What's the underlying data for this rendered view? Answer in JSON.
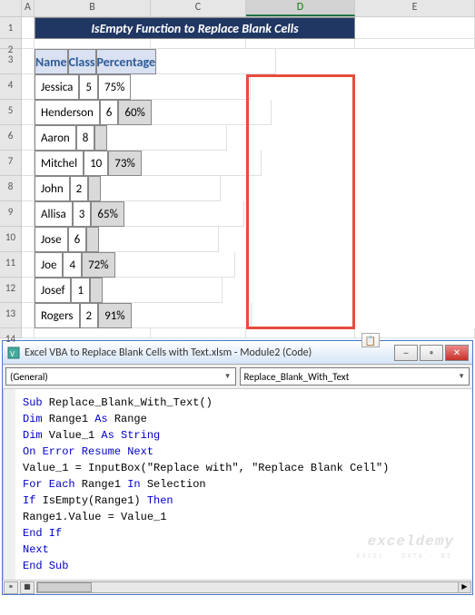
{
  "columns": [
    "A",
    "B",
    "C",
    "D",
    "E"
  ],
  "row_nums": [
    "1",
    "2",
    "3",
    "4",
    "5",
    "6",
    "7",
    "8",
    "9",
    "10",
    "11",
    "12",
    "13",
    "14"
  ],
  "selected_col": "D",
  "title": "IsEmpty Function to Replace Blank Cells",
  "headers": {
    "name": "Name",
    "class": "Class",
    "pct": "Percentage"
  },
  "data": [
    {
      "name": "Jessica",
      "class": "5",
      "pct": "75%",
      "active": true
    },
    {
      "name": "Henderson",
      "class": "6",
      "pct": "60%"
    },
    {
      "name": "Aaron",
      "class": "8",
      "pct": ""
    },
    {
      "name": "Mitchel",
      "class": "10",
      "pct": "73%"
    },
    {
      "name": "John",
      "class": "2",
      "pct": ""
    },
    {
      "name": "Allisa",
      "class": "3",
      "pct": "65%"
    },
    {
      "name": "Jose",
      "class": "6",
      "pct": ""
    },
    {
      "name": "Joe",
      "class": "4",
      "pct": "72%"
    },
    {
      "name": "Josef",
      "class": "1",
      "pct": ""
    },
    {
      "name": "Rogers",
      "class": "2",
      "pct": "91%"
    }
  ],
  "vbe": {
    "title": "Excel VBA to Replace Blank Cells with Text.xlsm - Module2 (Code)",
    "dd_left": "(General)",
    "dd_right": "Replace_Blank_With_Text",
    "code": {
      "l1a": "Sub",
      "l1b": " Replace_Blank_With_Text()",
      "l2a": "Dim",
      "l2b": " Range1 ",
      "l2c": "As",
      "l2d": " Range",
      "l3a": "Dim",
      "l3b": " Value_1 ",
      "l3c": "As String",
      "l4": "On Error Resume Next",
      "l5a": "Value_1 = InputBox(",
      "l5b": "\"Replace with\"",
      "l5c": ", ",
      "l5d": "\"Replace Blank Cell\"",
      "l5e": ")",
      "l6a": "For Each",
      "l6b": " Range1 ",
      "l6c": "In",
      "l6d": " Selection",
      "l7a": "If",
      "l7b": " IsEmpty(Range1) ",
      "l7c": "Then",
      "l8": "Range1.Value = Value_1",
      "l9": "End If",
      "l10": "Next",
      "l11": "End Sub"
    }
  },
  "watermark": "exceldemy",
  "watermark_sub": "EXCEL · DATA · BI"
}
